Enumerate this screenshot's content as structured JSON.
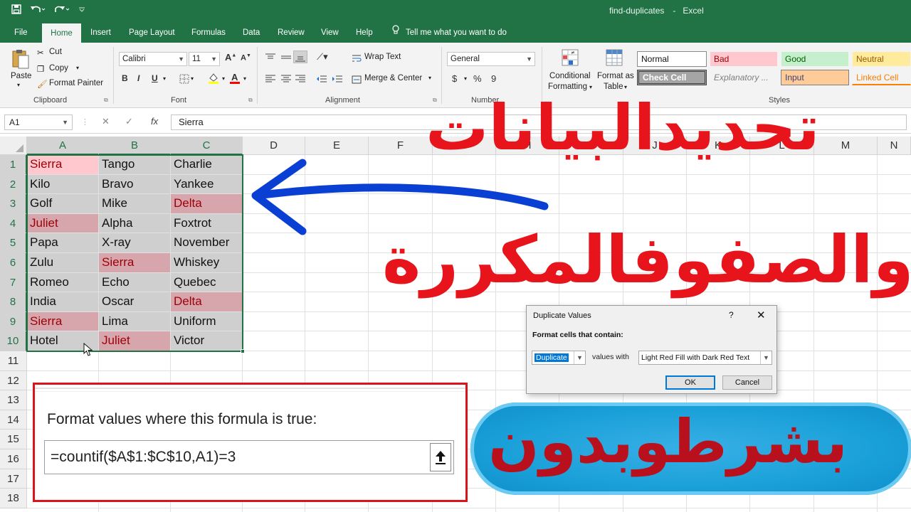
{
  "window": {
    "doc_name": "find-duplicates",
    "app_name": "Excel"
  },
  "tabs": [
    "File",
    "Home",
    "Insert",
    "Page Layout",
    "Formulas",
    "Data",
    "Review",
    "View",
    "Help"
  ],
  "tell_me": "Tell me what you want to do",
  "clipboard": {
    "paste": "Paste",
    "cut": "Cut",
    "copy": "Copy",
    "format_painter": "Format Painter",
    "label": "Clipboard"
  },
  "font": {
    "name": "Calibri",
    "size": "11",
    "label": "Font",
    "bold": "B",
    "italic": "I",
    "underline": "U"
  },
  "alignment": {
    "wrap_text": "Wrap Text",
    "merge_center": "Merge & Center",
    "label": "Alignment"
  },
  "number": {
    "format": "General",
    "currency": "$",
    "percent": "%",
    "comma": "9",
    "label": "Number"
  },
  "styles": {
    "conditional_formatting_1": "Conditional",
    "conditional_formatting_2": "Formatting",
    "format_as_table_1": "Format as",
    "format_as_table_2": "Table",
    "normal": "Normal",
    "bad": "Bad",
    "good": "Good",
    "neutral": "Neutral",
    "check_cell": "Check Cell",
    "explanatory": "Explanatory ...",
    "input": "Input",
    "linked_cell": "Linked Cell",
    "label": "Styles"
  },
  "formula_bar": {
    "name_box": "A1",
    "cancel": "✕",
    "enter": "✓",
    "fx": "fx",
    "value": "Sierra"
  },
  "columns": [
    "A",
    "B",
    "C",
    "D",
    "E",
    "F",
    "G",
    "H",
    "I",
    "J",
    "K",
    "L",
    "M",
    "N"
  ],
  "rows": [
    "1",
    "2",
    "3",
    "4",
    "5",
    "6",
    "7",
    "8",
    "9",
    "10",
    "11",
    "12",
    "13",
    "14",
    "15",
    "16",
    "17",
    "18"
  ],
  "cells": [
    [
      "Sierra",
      "Tango",
      "Charlie"
    ],
    [
      "Kilo",
      "Bravo",
      "Yankee"
    ],
    [
      "Golf",
      "Mike",
      "Delta"
    ],
    [
      "Juliet",
      "Alpha",
      "Foxtrot"
    ],
    [
      "Papa",
      "X-ray",
      "November"
    ],
    [
      "Zulu",
      "Sierra",
      "Whiskey"
    ],
    [
      "Romeo",
      "Echo",
      "Quebec"
    ],
    [
      "India",
      "Oscar",
      "Delta"
    ],
    [
      "Sierra",
      "Lima",
      "Uniform"
    ],
    [
      "Hotel",
      "Juliet",
      "Victor"
    ]
  ],
  "overlay_text": {
    "line1": "تحديدالبيانات",
    "line2": "والصفوفالمكررة",
    "line3": "بشرطوبدون"
  },
  "dialog": {
    "title": "Duplicate Values",
    "help": "?",
    "close": "✕",
    "subtitle": "Format cells that contain:",
    "type_value": "Duplicate",
    "values_with": "values with",
    "format_value": "Light Red Fill with Dark Red Text",
    "ok": "OK",
    "cancel": "Cancel"
  },
  "callout": {
    "title": "Format values where this formula is true:",
    "formula": "=countif($A$1:$C$10,A1)=3"
  },
  "colors": {
    "excel_green": "#217346",
    "dup_fill": "#ffc7ce",
    "dup_text": "#9c0006",
    "overlay_red": "#e8141c",
    "pill_text": "#b8101c"
  }
}
